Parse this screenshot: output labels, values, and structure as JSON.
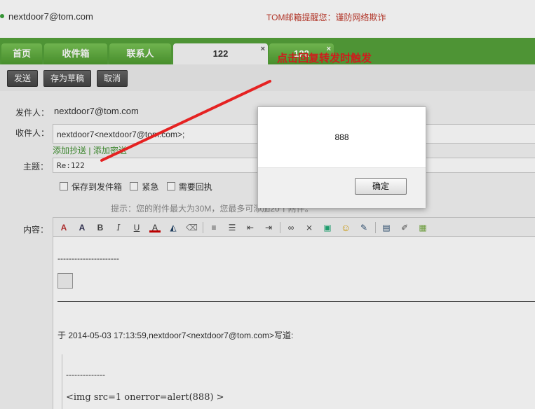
{
  "header": {
    "user_email": "nextdoor7@tom.com",
    "notice": "TOM邮箱提醒您：谨防网络欺诈"
  },
  "tabs": [
    {
      "label": "首页"
    },
    {
      "label": "收件箱"
    },
    {
      "label": "联系人"
    },
    {
      "label": "122",
      "active": true,
      "close": "×"
    },
    {
      "label": "122",
      "close": "×"
    }
  ],
  "annotation": "点击回复转发时触发",
  "toolbar": {
    "send_label": "发送",
    "draft_label": "存为草稿",
    "cancel_label": "取消"
  },
  "form": {
    "from_label": "发件人：",
    "from_value": "nextdoor7@tom.com",
    "to_label": "收件人：",
    "to_value": "nextdoor7<nextdoor7@tom.com>;",
    "add_cc": "添加抄送",
    "link_sep": "|",
    "add_bcc": "添加密送",
    "subject_label": "主题：",
    "subject_value": "Re:122",
    "option_save": "保存到发件箱",
    "option_urgent": "紧急",
    "option_receipt": "需要回执",
    "hint": "提示：您的附件最大为30M，您最多可添加20个附件。",
    "content_label": "内容："
  },
  "editor": {
    "separator1": "----------------------",
    "quote_line": "于 2014-05-03 17:13:59,nextdoor7<nextdoor7@tom.com>写道:",
    "separator2": "--------------",
    "code_line": "<img src=1 onerror=alert(888) >"
  },
  "dialog": {
    "message": "888",
    "ok_label": "确定"
  },
  "colors": {
    "tab_bar": "#55a13a",
    "annotation": "#e02020",
    "notice": "#c0392b",
    "link": "#3e8f2e"
  }
}
